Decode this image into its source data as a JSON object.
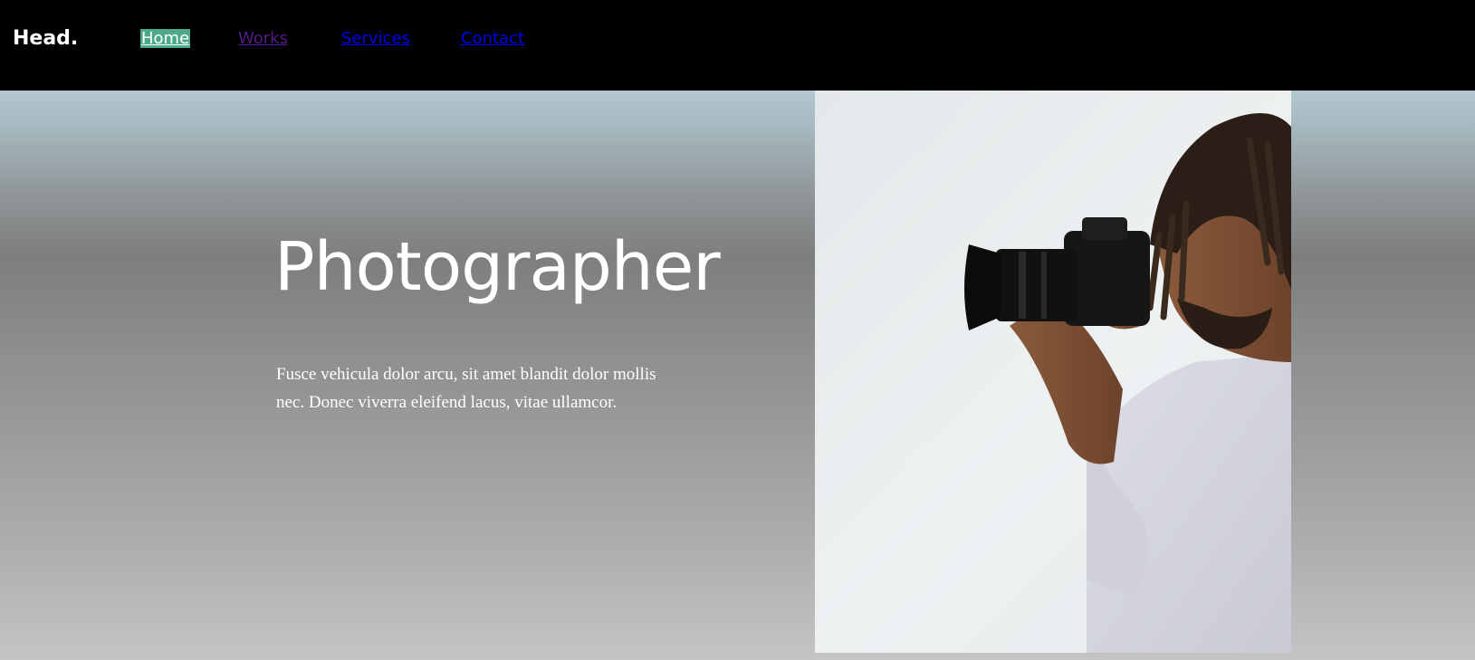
{
  "header": {
    "logo": "Head.",
    "nav": [
      {
        "label": "Home",
        "state": "active"
      },
      {
        "label": "Works",
        "state": "visited"
      },
      {
        "label": "Services",
        "state": "default"
      },
      {
        "label": "Contact",
        "state": "default"
      }
    ]
  },
  "hero": {
    "title": "Photographer",
    "description": "Fusce vehicula dolor arcu, sit amet blandit dolor mollis nec. Donec viverra eleifend lacus, vitae ullamcor.",
    "image_alt": "photographer-with-camera"
  },
  "colors": {
    "header_bg": "#000000",
    "active_nav_bg": "#4ea88a",
    "visited_link": "#551a8b",
    "link": "#0000ee"
  }
}
